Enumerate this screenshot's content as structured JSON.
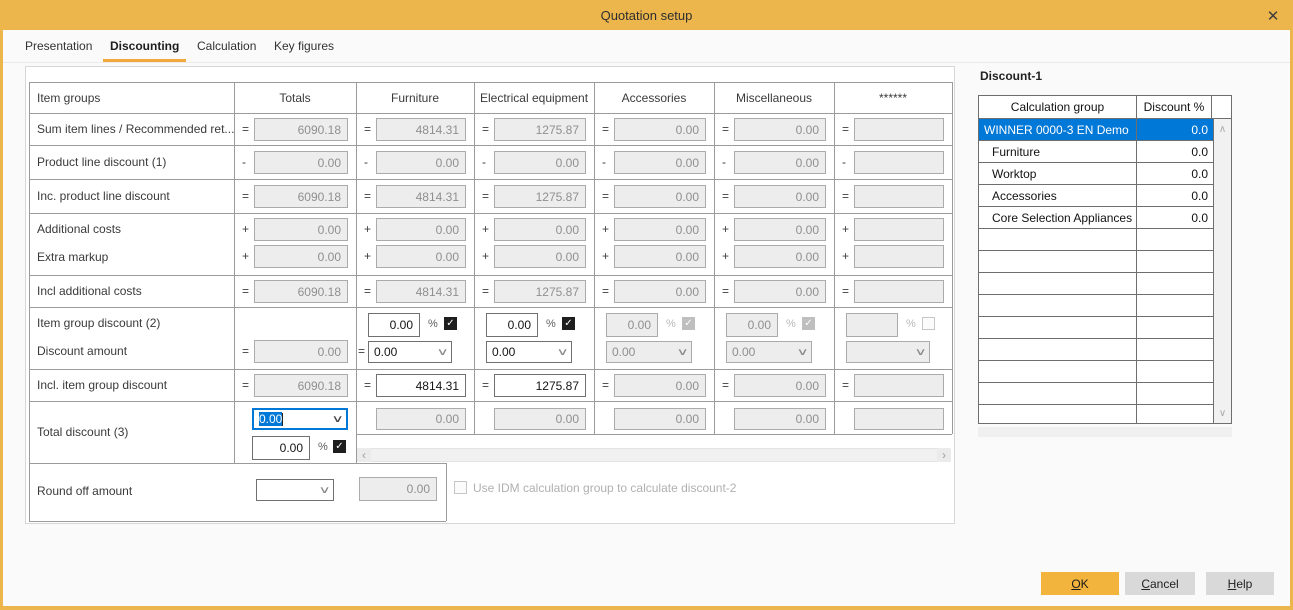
{
  "window": {
    "title": "Quotation setup",
    "close_glyph": "✕"
  },
  "tabs": [
    {
      "label": "Presentation",
      "active": false
    },
    {
      "label": "Discounting",
      "active": true
    },
    {
      "label": "Calculation",
      "active": false
    },
    {
      "label": "Key figures",
      "active": false
    }
  ],
  "grid": {
    "headers": [
      "Item groups",
      "Totals",
      "Furniture",
      "Electrical equipment",
      "Accessories",
      "Miscellaneous",
      "******"
    ],
    "rows": [
      {
        "label": "Sum item lines / Recommended ret...",
        "cells": [
          {
            "kind": "val",
            "op": "=",
            "v": "6090.18"
          },
          {
            "kind": "val",
            "op": "=",
            "v": "4814.31"
          },
          {
            "kind": "val",
            "op": "=",
            "v": "1275.87"
          },
          {
            "kind": "val",
            "op": "=",
            "v": "0.00"
          },
          {
            "kind": "val",
            "op": "=",
            "v": "0.00"
          },
          {
            "kind": "val",
            "op": "=",
            "v": ""
          }
        ]
      },
      {
        "label": "Product line discount (1)",
        "cells": [
          {
            "kind": "val",
            "op": "-",
            "v": "0.00"
          },
          {
            "kind": "val",
            "op": "-",
            "v": "0.00"
          },
          {
            "kind": "val",
            "op": "-",
            "v": "0.00"
          },
          {
            "kind": "val",
            "op": "-",
            "v": "0.00"
          },
          {
            "kind": "val",
            "op": "-",
            "v": "0.00"
          },
          {
            "kind": "val",
            "op": "-",
            "v": ""
          }
        ]
      },
      {
        "label": "Inc. product line discount",
        "cells": [
          {
            "kind": "val",
            "op": "=",
            "v": "6090.18"
          },
          {
            "kind": "val",
            "op": "=",
            "v": "4814.31"
          },
          {
            "kind": "val",
            "op": "=",
            "v": "1275.87"
          },
          {
            "kind": "val",
            "op": "=",
            "v": "0.00"
          },
          {
            "kind": "val",
            "op": "=",
            "v": "0.00"
          },
          {
            "kind": "val",
            "op": "=",
            "v": ""
          }
        ]
      },
      {
        "label": "Additional costs",
        "label2": "Extra markup",
        "cells": [
          {
            "kind": "val2",
            "op": "+",
            "v": "0.00",
            "v2": "0.00"
          },
          {
            "kind": "val2",
            "op": "+",
            "v": "0.00",
            "v2": "0.00"
          },
          {
            "kind": "val2",
            "op": "+",
            "v": "0.00",
            "v2": "0.00"
          },
          {
            "kind": "val2",
            "op": "+",
            "v": "0.00",
            "v2": "0.00"
          },
          {
            "kind": "val2",
            "op": "+",
            "v": "0.00",
            "v2": "0.00"
          },
          {
            "kind": "val2",
            "op": "+",
            "v": "",
            "v2": ""
          }
        ]
      },
      {
        "label": "Incl additional costs",
        "cells": [
          {
            "kind": "val",
            "op": "=",
            "v": "6090.18"
          },
          {
            "kind": "val",
            "op": "=",
            "v": "4814.31"
          },
          {
            "kind": "val",
            "op": "=",
            "v": "1275.87"
          },
          {
            "kind": "val",
            "op": "=",
            "v": "0.00"
          },
          {
            "kind": "val",
            "op": "=",
            "v": "0.00"
          },
          {
            "kind": "val",
            "op": "=",
            "v": ""
          }
        ]
      },
      {
        "label": "Item group discount (2)",
        "label2": "Discount amount",
        "cells": [
          {
            "kind": "amount",
            "op": "=",
            "v": "0.00"
          },
          {
            "kind": "pctdd",
            "pct": "0.00",
            "checked": true,
            "enabled": true,
            "ddop": "=",
            "dd": "0.00"
          },
          {
            "kind": "pctdd",
            "pct": "0.00",
            "checked": true,
            "enabled": true,
            "dd": "0.00"
          },
          {
            "kind": "pctdd",
            "pct": "0.00",
            "checked": true,
            "enabled": false,
            "dd": "0.00"
          },
          {
            "kind": "pctdd",
            "pct": "0.00",
            "checked": true,
            "enabled": false,
            "dd": "0.00"
          },
          {
            "kind": "pctdd",
            "pct": "",
            "checked": false,
            "enabled": false,
            "dd": ""
          }
        ]
      },
      {
        "label": "Incl. item group discount",
        "cells": [
          {
            "kind": "val",
            "op": "=",
            "v": "6090.18"
          },
          {
            "kind": "val",
            "op": "=",
            "v": "4814.31",
            "enabled": true
          },
          {
            "kind": "val",
            "op": "=",
            "v": "1275.87",
            "enabled": true
          },
          {
            "kind": "val",
            "op": "=",
            "v": "0.00"
          },
          {
            "kind": "val",
            "op": "=",
            "v": "0.00"
          },
          {
            "kind": "val",
            "op": "=",
            "v": ""
          }
        ]
      },
      {
        "label": "Total discount (3)",
        "cells": [
          {
            "kind": "focusdd",
            "dd": "0.00",
            "pct": "0.00",
            "checked": true
          },
          {
            "kind": "box",
            "v": "0.00"
          },
          {
            "kind": "box",
            "v": "0.00"
          },
          {
            "kind": "box",
            "v": "0.00"
          },
          {
            "kind": "box",
            "v": "0.00"
          },
          {
            "kind": "box",
            "v": ""
          }
        ]
      }
    ]
  },
  "round_off": {
    "label": "Round off amount",
    "dropdown_value": "",
    "amount": "0.00"
  },
  "idm_checkbox": {
    "label": "Use IDM calculation group to calculate discount-2",
    "checked": false,
    "enabled": false
  },
  "discount_panel": {
    "title": "Discount-1",
    "columns": [
      "Calculation group",
      "Discount %"
    ],
    "rows": [
      {
        "name": "WINNER 0000-3 EN Demo",
        "value": "0.0",
        "selected": true,
        "indent": false
      },
      {
        "name": "Furniture",
        "value": "0.0",
        "selected": false,
        "indent": true
      },
      {
        "name": "Worktop",
        "value": "0.0",
        "selected": false,
        "indent": true
      },
      {
        "name": "Accessories",
        "value": "0.0",
        "selected": false,
        "indent": true
      },
      {
        "name": "Core Selection Appliances",
        "value": "0.0",
        "selected": false,
        "indent": true
      }
    ],
    "empty_rows": 9
  },
  "buttons": [
    {
      "label": "OK",
      "accent": true
    },
    {
      "label": "Cancel",
      "accent": false
    },
    {
      "label": "Help",
      "accent": false
    }
  ],
  "colors": {
    "accent": "#ECB64C",
    "ok_button": "#F2B43D",
    "selection": "#0078D7"
  }
}
